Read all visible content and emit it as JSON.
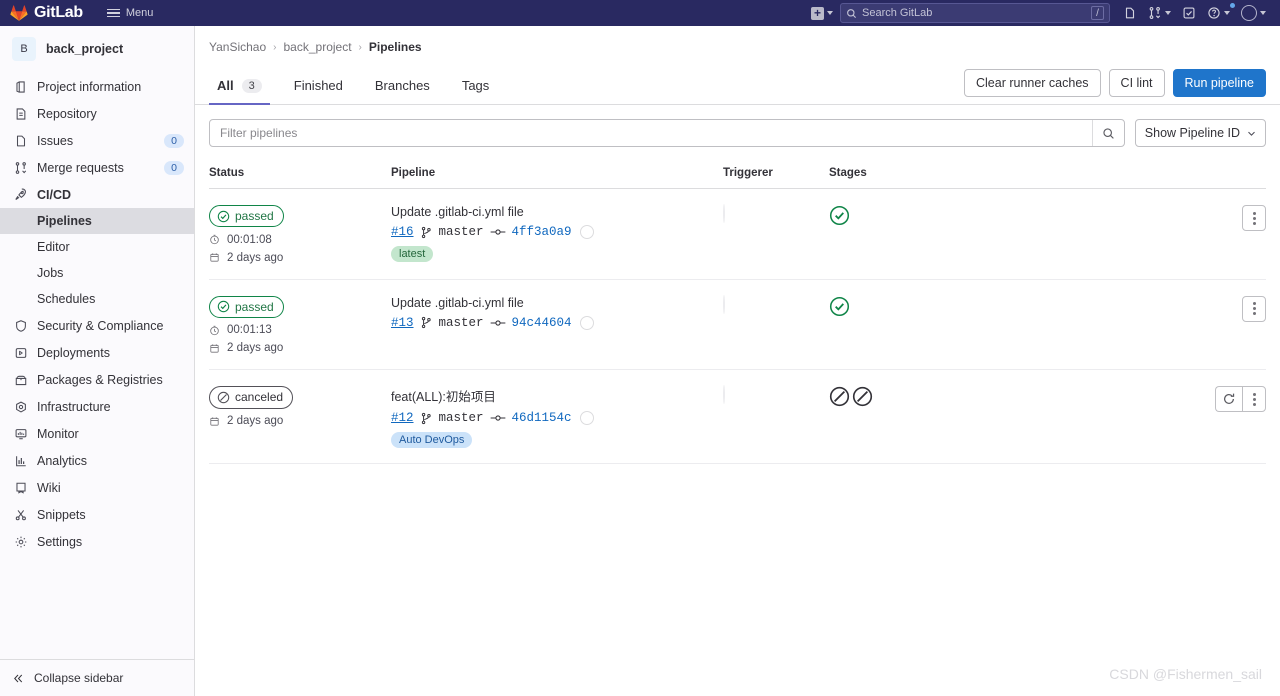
{
  "navbar": {
    "brand": "GitLab",
    "menu_label": "Menu",
    "search_placeholder": "Search GitLab",
    "search_shortcut": "/",
    "plus_label": "+",
    "icons": [
      "plus-square-icon",
      "search-icon",
      "issues-icon",
      "merge-requests-icon",
      "todos-icon",
      "help-icon",
      "user-avatar-icon"
    ],
    "bg_color": "#292961"
  },
  "sidebar": {
    "project_initial": "B",
    "project_name": "back_project",
    "items": [
      {
        "label": "Project information",
        "icon": "project-info-icon",
        "badge": ""
      },
      {
        "label": "Repository",
        "icon": "repository-icon",
        "badge": ""
      },
      {
        "label": "Issues",
        "icon": "issues-icon",
        "badge": "0"
      },
      {
        "label": "Merge requests",
        "icon": "merge-requests-icon",
        "badge": "0"
      },
      {
        "label": "CI/CD",
        "icon": "rocket-icon",
        "badge": ""
      }
    ],
    "cicd_children": [
      {
        "label": "Pipelines",
        "active": true
      },
      {
        "label": "Editor",
        "active": false
      },
      {
        "label": "Jobs",
        "active": false
      },
      {
        "label": "Schedules",
        "active": false
      }
    ],
    "items_after": [
      {
        "label": "Security & Compliance",
        "icon": "shield-icon"
      },
      {
        "label": "Deployments",
        "icon": "deployments-icon"
      },
      {
        "label": "Packages & Registries",
        "icon": "package-icon"
      },
      {
        "label": "Infrastructure",
        "icon": "infrastructure-icon"
      },
      {
        "label": "Monitor",
        "icon": "monitor-icon"
      },
      {
        "label": "Analytics",
        "icon": "analytics-icon"
      },
      {
        "label": "Wiki",
        "icon": "wiki-icon"
      },
      {
        "label": "Snippets",
        "icon": "snippets-icon"
      },
      {
        "label": "Settings",
        "icon": "gear-icon"
      }
    ],
    "collapse_label": "Collapse sidebar"
  },
  "breadcrumb": {
    "owner": "YanSichao",
    "project": "back_project",
    "page": "Pipelines"
  },
  "tabs": [
    {
      "label": "All",
      "count": "3",
      "active": true
    },
    {
      "label": "Finished",
      "count": "",
      "active": false
    },
    {
      "label": "Branches",
      "count": "",
      "active": false
    },
    {
      "label": "Tags",
      "count": "",
      "active": false
    }
  ],
  "actions": {
    "clear_runner_caches": "Clear runner caches",
    "ci_lint": "CI lint",
    "run_pipeline": "Run pipeline",
    "primary_color": "#1f75cb"
  },
  "filter": {
    "placeholder": "Filter pipelines",
    "value": "",
    "dropdown_label": "Show Pipeline ID"
  },
  "table": {
    "headers": {
      "status": "Status",
      "pipeline": "Pipeline",
      "triggerer": "Triggerer",
      "stages": "Stages"
    },
    "rows": [
      {
        "status": "passed",
        "status_type": "passed",
        "duration": "00:01:08",
        "age": "2 days ago",
        "title": "Update .gitlab-ci.yml file",
        "pipeline_id": "#16",
        "branch": "master",
        "commit": "4ff3a0a9",
        "tag": "latest",
        "tag_type": "latest",
        "stages": [
          "passed"
        ],
        "has_retry": false
      },
      {
        "status": "passed",
        "status_type": "passed",
        "duration": "00:01:13",
        "age": "2 days ago",
        "title": "Update .gitlab-ci.yml file",
        "pipeline_id": "#13",
        "branch": "master",
        "commit": "94c44604",
        "tag": "",
        "tag_type": "",
        "stages": [
          "passed"
        ],
        "has_retry": false
      },
      {
        "status": "canceled",
        "status_type": "canceled",
        "duration": "",
        "age": "2 days ago",
        "title": "feat(ALL):初始项目",
        "pipeline_id": "#12",
        "branch": "master",
        "commit": "46d1154c",
        "tag": "Auto DevOps",
        "tag_type": "devops",
        "stages": [
          "canceled",
          "canceled"
        ],
        "has_retry": true
      }
    ]
  },
  "watermark": "CSDN @Fishermen_sail"
}
